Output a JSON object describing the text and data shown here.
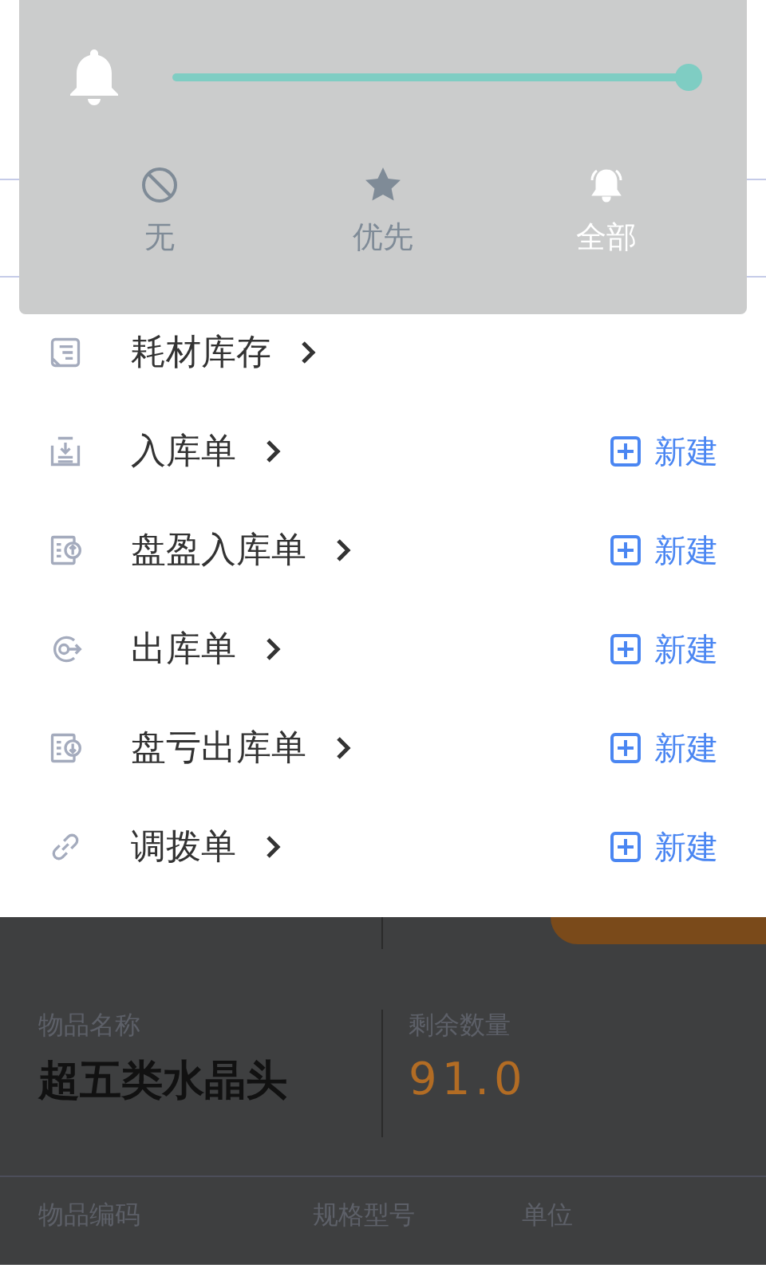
{
  "notify": {
    "level": 1
  },
  "modes": [
    {
      "kind": "none",
      "label": "无",
      "selected": false
    },
    {
      "kind": "star",
      "label": "优先",
      "selected": false
    },
    {
      "kind": "all",
      "label": "全部",
      "selected": true
    }
  ],
  "menu": [
    {
      "kind": "stock",
      "label": "耗材库存"
    },
    {
      "kind": "inbound",
      "label": "入库单",
      "action": "新建"
    },
    {
      "kind": "surplus",
      "label": "盘盈入库单",
      "action": "新建"
    },
    {
      "kind": "outbound",
      "label": "出库单",
      "action": "新建"
    },
    {
      "kind": "loss",
      "label": "盘亏出库单",
      "action": "新建"
    },
    {
      "kind": "transfer",
      "label": "调拨单",
      "action": "新建"
    }
  ],
  "item": {
    "name_label": "物品名称",
    "name": "超五类水晶头",
    "qty_label": "剩余数量",
    "qty": "91.0",
    "columns": [
      {
        "label": "物品编码"
      },
      {
        "label": "规格型号"
      },
      {
        "label": "单位"
      }
    ]
  }
}
